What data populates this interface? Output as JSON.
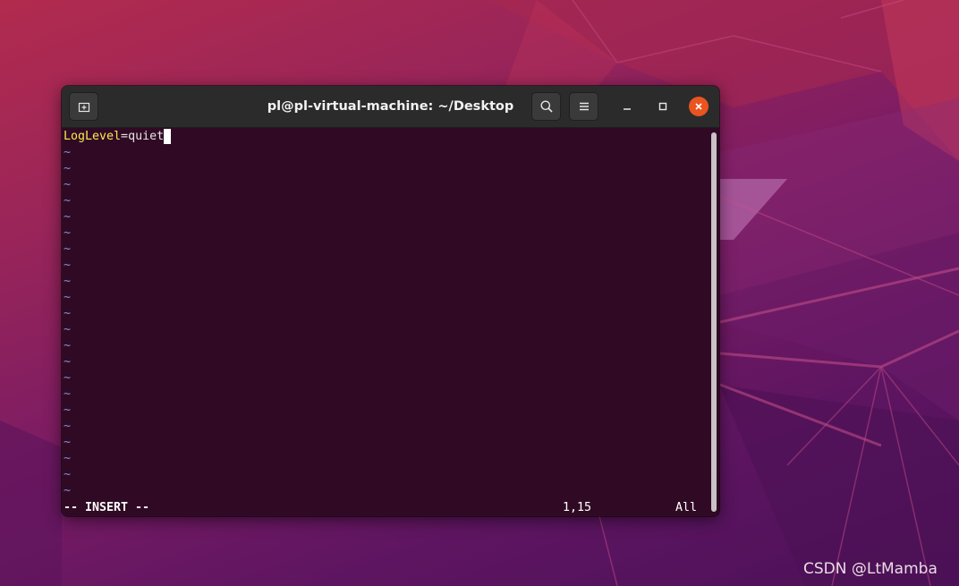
{
  "window": {
    "title": "pl@pl-virtual-machine: ~/Desktop"
  },
  "icons": {
    "new_tab": "new-tab-icon",
    "search": "search-icon",
    "menu": "hamburger-menu-icon",
    "minimize": "minimize-icon",
    "maximize": "maximize-icon",
    "close": "close-icon"
  },
  "colors": {
    "terminal_bg": "#300a24",
    "headerbar_bg": "#2b2b2b",
    "close_button": "#e95420",
    "syntax_key": "#fce94f",
    "tilde": "#8c8cd9"
  },
  "editor": {
    "line1": {
      "key": "LogLevel",
      "equals": "=",
      "value": "quiet"
    },
    "empty_line_marker": "~",
    "status": {
      "mode": "-- INSERT --",
      "position": "1,15",
      "scroll": "All"
    }
  },
  "watermark": "CSDN @LtMamba"
}
